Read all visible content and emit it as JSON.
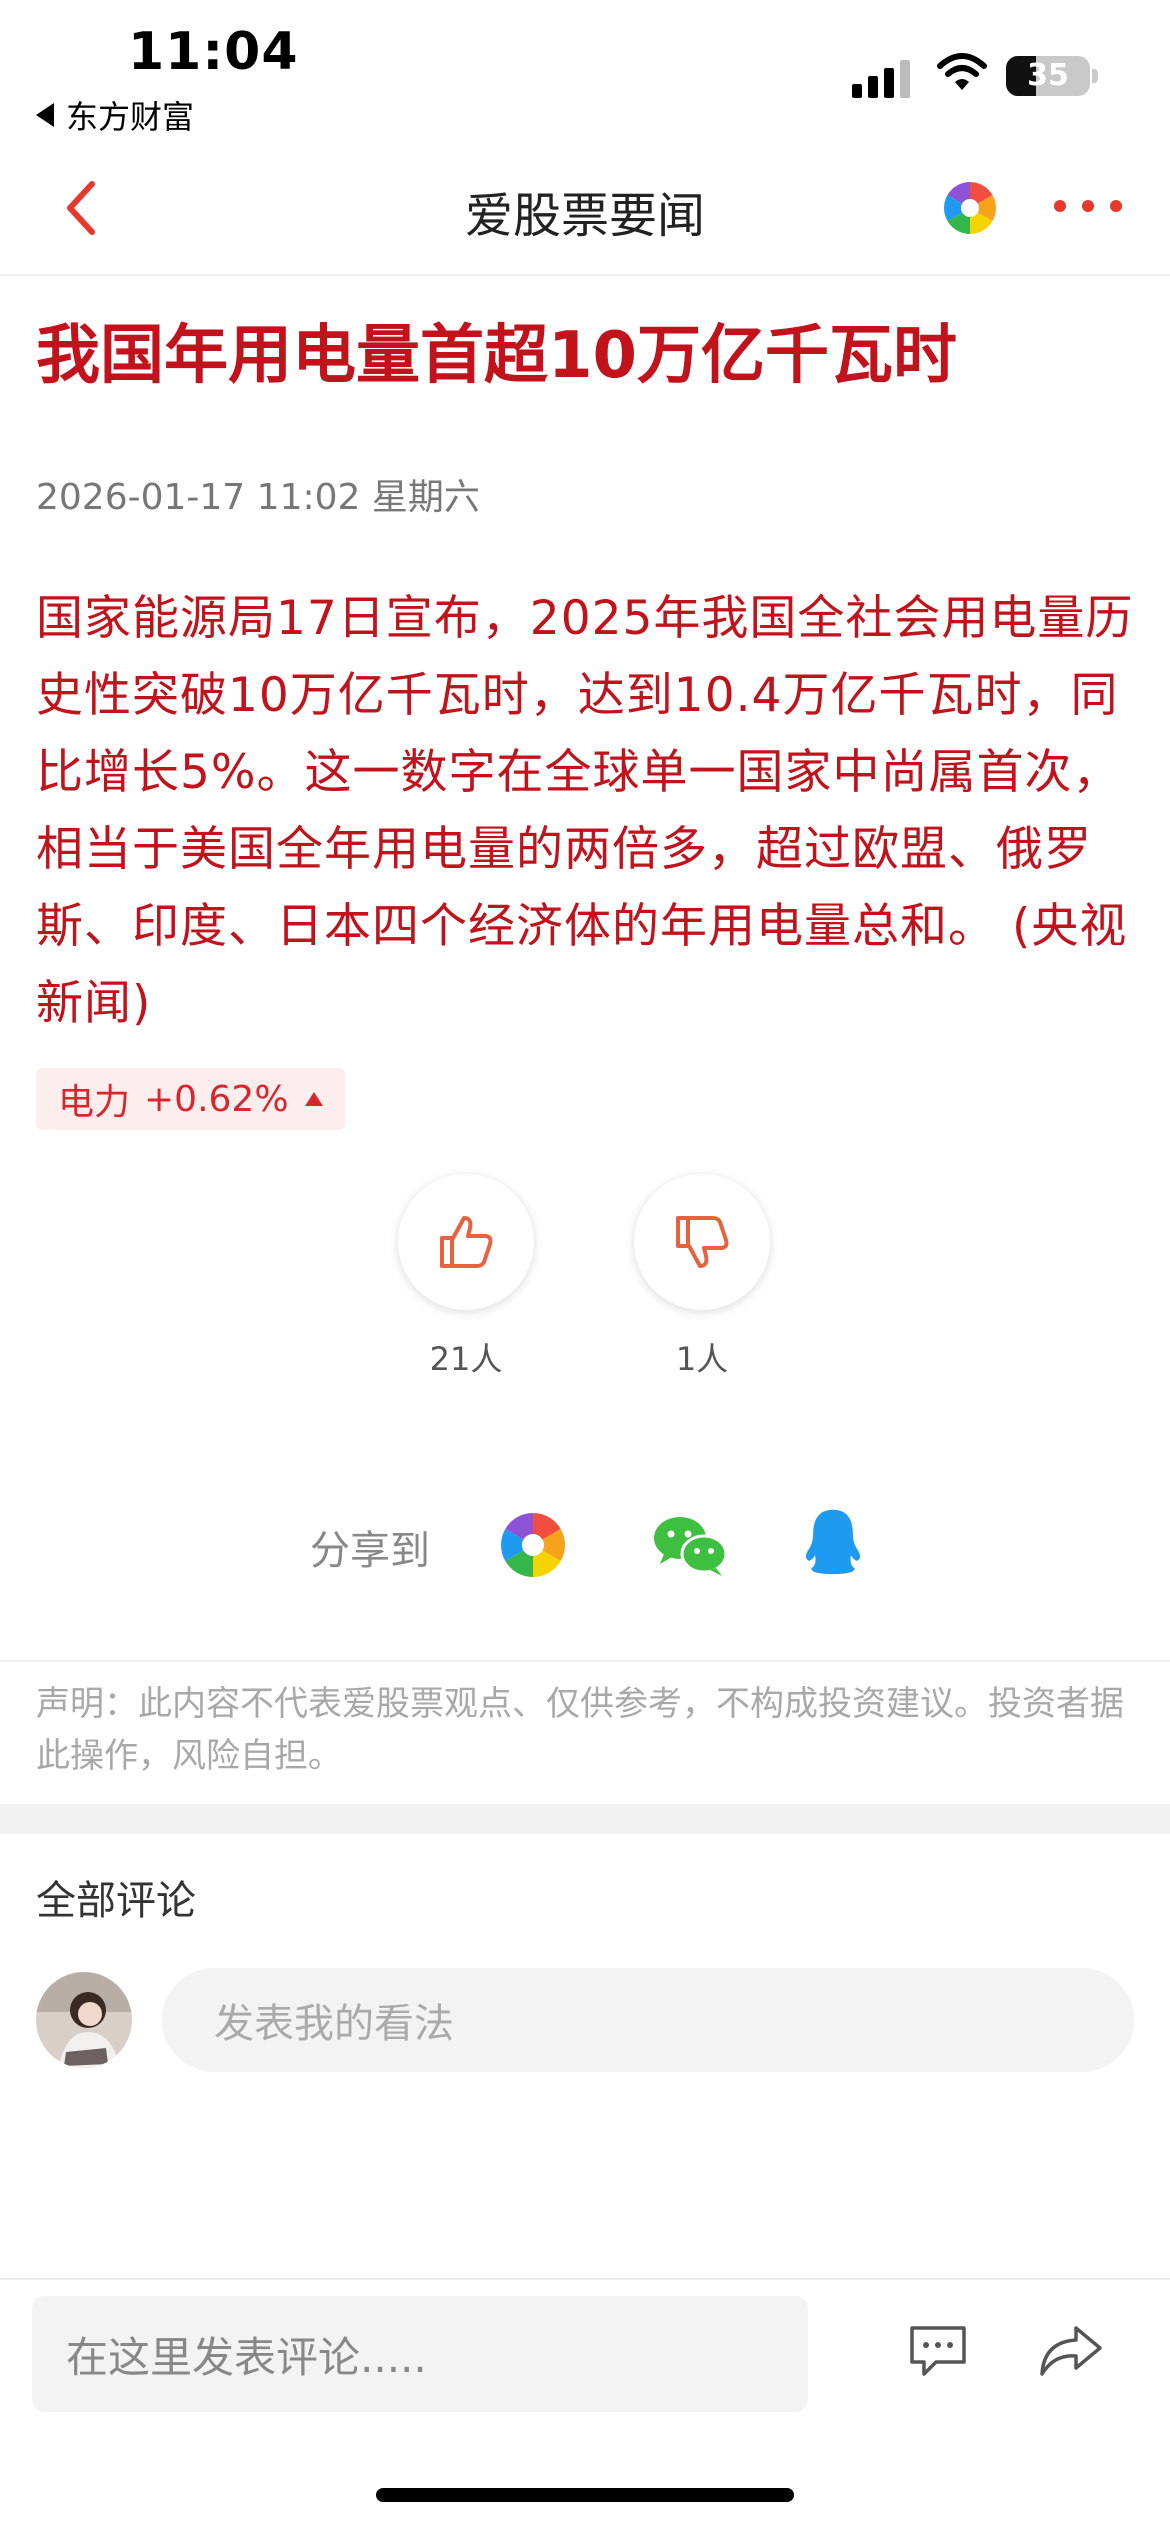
{
  "status_bar": {
    "time": "11:04",
    "back_app": "东方财富",
    "battery": "35"
  },
  "nav": {
    "title": "爱股票要闻"
  },
  "article": {
    "headline": "我国年用电量首超10万亿千瓦时",
    "date": "2026-01-17 11:02 星期六",
    "body": "国家能源局17日宣布，2025年我国全社会用电量历史性突破10万亿千瓦时，达到10.4万亿千瓦时，同比增长5%。这一数字在全球单一国家中尚属首次，相当于美国全年用电量的两倍多，超过欧盟、俄罗斯、印度、日本四个经济体的年用电量总和。 (央视新闻)",
    "stock_tag": {
      "name": "电力",
      "change": "+0.62%"
    }
  },
  "votes": {
    "like_count": "21人",
    "dislike_count": "1人"
  },
  "share": {
    "label": "分享到",
    "targets": [
      "aigupiao-icon",
      "wechat-icon",
      "qq-icon"
    ]
  },
  "disclaimer": "声明：此内容不代表爱股票观点、仅供参考，不构成投资建议。投资者据此操作，风险自担。",
  "comments": {
    "title": "全部评论",
    "placeholder": "发表我的看法"
  },
  "bottom_bar": {
    "input_placeholder": "在这里发表评论....."
  },
  "colors": {
    "accent": "#c2121b",
    "up": "#d9262e",
    "icon_orange": "#e8623f",
    "qq_blue": "#1e9bf0",
    "wechat_green": "#3fbf3f"
  }
}
